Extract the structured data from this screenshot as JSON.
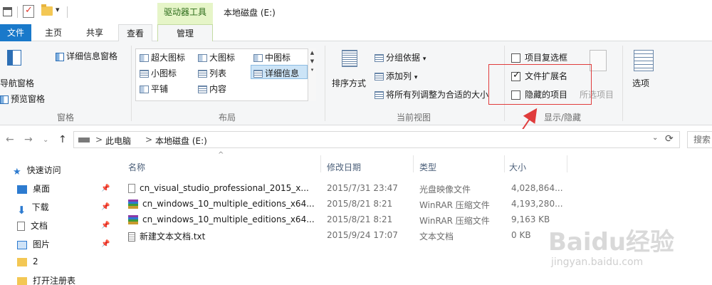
{
  "titlebar": {
    "dropdown_glyph": "▾",
    "context_tab": "驱动器工具",
    "title": "本地磁盘 (E:)"
  },
  "ribbon_tabs": {
    "file": "文件",
    "home": "主页",
    "share": "共享",
    "view": "查看",
    "manage": "管理"
  },
  "ribbon": {
    "panes": {
      "nav_pane": "导航窗格",
      "preview_pane": "预览窗格",
      "details_pane": "详细信息窗格",
      "group_label": "窗格"
    },
    "layout": {
      "extra_large": "超大图标",
      "large": "大图标",
      "medium": "中图标",
      "small": "小图标",
      "list": "列表",
      "details": "详细信息",
      "tiles": "平铺",
      "content": "内容",
      "group_label": "布局"
    },
    "current_view": {
      "sort_by": "排序方式",
      "group_by": "分组依据",
      "add_columns": "添加列",
      "fit_columns": "将所有列调整为合适的大小",
      "group_label": "当前视图"
    },
    "show_hide": {
      "item_checkboxes": "项目复选框",
      "file_extensions": "文件扩展名",
      "hidden_items": "隐藏的项目",
      "hide_selected": "所选项目",
      "group_label": "显示/隐藏",
      "item_checkboxes_checked": false,
      "file_extensions_checked": true,
      "hidden_items_checked": false
    },
    "options": "选项"
  },
  "address": {
    "crumb_pc": "此电脑",
    "crumb_drive": "本地磁盘 (E:)",
    "separator": ">",
    "search_placeholder": "搜索"
  },
  "nav": {
    "quick_access": "快速访问",
    "items": [
      {
        "label": "桌面",
        "icon": "desktop-icon",
        "pinned": true
      },
      {
        "label": "下载",
        "icon": "download-icon",
        "pinned": true
      },
      {
        "label": "文档",
        "icon": "document-icon",
        "pinned": true
      },
      {
        "label": "图片",
        "icon": "picture-icon",
        "pinned": true
      },
      {
        "label": "2",
        "icon": "folder-icon",
        "pinned": false
      },
      {
        "label": "打开注册表",
        "icon": "folder-icon",
        "pinned": false
      }
    ]
  },
  "filelist": {
    "columns": {
      "name": "名称",
      "modified": "修改日期",
      "type": "类型",
      "size": "大小"
    },
    "rows": [
      {
        "name": "cn_visual_studio_professional_2015_x...",
        "modified": "2015/7/31 23:47",
        "type": "光盘映像文件",
        "size": "4,028,864...",
        "icon": "iso-file-icon"
      },
      {
        "name": "cn_windows_10_multiple_editions_x64...",
        "modified": "2015/8/21 8:21",
        "type": "WinRAR 压缩文件",
        "size": "4,193,280...",
        "icon": "rar-file-icon"
      },
      {
        "name": "cn_windows_10_multiple_editions_x64...",
        "modified": "2015/8/21 8:21",
        "type": "WinRAR 压缩文件",
        "size": "9,163 KB",
        "icon": "rar-file-icon"
      },
      {
        "name": "新建文本文档.txt",
        "modified": "2015/9/24 17:07",
        "type": "文本文档",
        "size": "0 KB",
        "icon": "txt-file-icon"
      }
    ]
  },
  "watermark": {
    "brand": "Baidu经验",
    "url": "jingyan.baidu.com"
  },
  "colors": {
    "file_tab": "#1979ca",
    "context_tab": "#e6f5c8",
    "annotation": "#e03c3c"
  }
}
